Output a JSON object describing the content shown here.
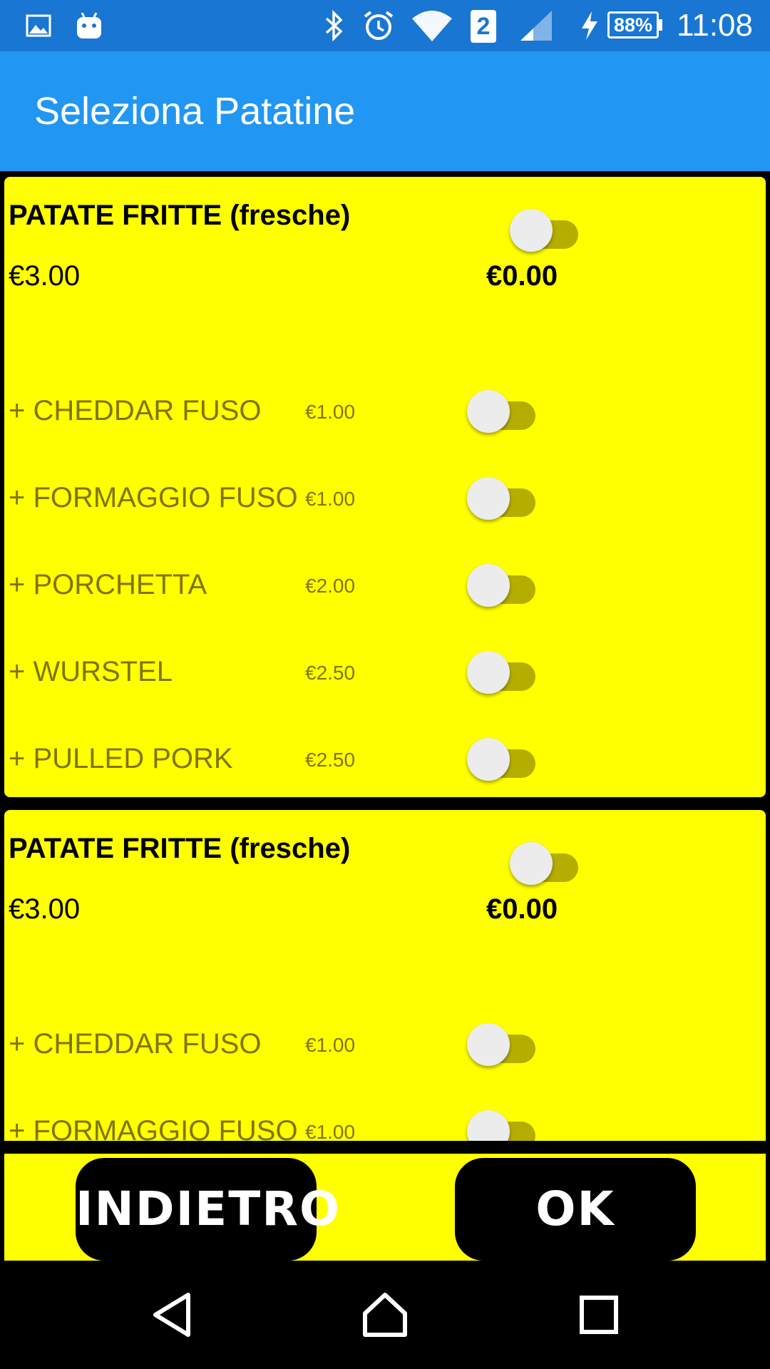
{
  "status_bar": {
    "icons": [
      "image-icon",
      "android-icon",
      "bluetooth-icon",
      "alarm-icon",
      "wifi-icon",
      "sim-2-icon",
      "signal-icon",
      "charging-icon"
    ],
    "sim_number": "2",
    "battery": "88%",
    "time": "11:08"
  },
  "app_bar": {
    "title": "Seleziona Patatine"
  },
  "cards": [
    {
      "title": "PATATE FRITTE (fresche)",
      "price": "€3.00",
      "total": "€0.00",
      "enabled": false,
      "addons": [
        {
          "name": "+ CHEDDAR FUSO",
          "price": "€1.00",
          "enabled": false
        },
        {
          "name": "+ FORMAGGIO FUSO",
          "price": "€1.00",
          "enabled": false
        },
        {
          "name": "+ PORCHETTA",
          "price": "€2.00",
          "enabled": false
        },
        {
          "name": "+ WURSTEL",
          "price": "€2.50",
          "enabled": false
        },
        {
          "name": "+ PULLED PORK",
          "price": "€2.50",
          "enabled": false
        }
      ]
    },
    {
      "title": "PATATE FRITTE (fresche)",
      "price": "€3.00",
      "total": "€0.00",
      "enabled": false,
      "addons": [
        {
          "name": "+ CHEDDAR FUSO",
          "price": "€1.00",
          "enabled": false
        },
        {
          "name": "+ FORMAGGIO FUSO",
          "price": "€1.00",
          "enabled": false
        }
      ]
    }
  ],
  "buttons": {
    "back": "INDIETRO",
    "ok": "OK"
  },
  "colors": {
    "status_bar": "#1976d2",
    "app_bar": "#2196f3",
    "card_background": "#ffff00",
    "addon_text": "#7f7500",
    "switch_track": "#b5ad00",
    "button_background": "#000000"
  }
}
